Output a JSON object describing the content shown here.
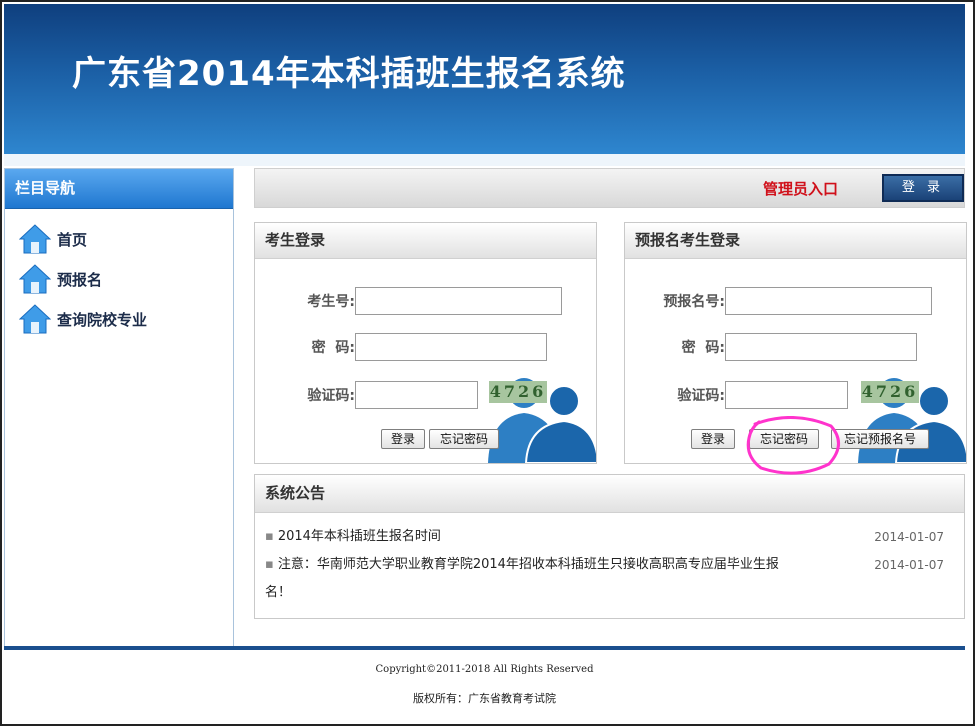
{
  "header": {
    "title": "广东省2014年本科插班生报名系统"
  },
  "sidebar": {
    "title": "栏目导航",
    "items": [
      {
        "label": "首页"
      },
      {
        "label": "预报名"
      },
      {
        "label": "查询院校专业"
      }
    ]
  },
  "admin": {
    "label": "管理员入口",
    "login_button": "登 录"
  },
  "student_login": {
    "title": "考生登录",
    "fields": {
      "id_label": "考生号:",
      "password_label": "密  码:",
      "captcha_label": "验证码:"
    },
    "captcha_text": "4726",
    "buttons": {
      "login": "登录",
      "forgot_password": "忘记密码"
    }
  },
  "pre_login": {
    "title": "预报名考生登录",
    "fields": {
      "id_label": "预报名号:",
      "password_label": "密  码:",
      "captcha_label": "验证码:"
    },
    "captcha_text": "4726",
    "buttons": {
      "login": "登录",
      "forgot_password": "忘记密码",
      "forgot_number": "忘记预报名号"
    }
  },
  "notices": {
    "title": "系统公告",
    "items": [
      {
        "text": "2014年本科插班生报名时间",
        "date": "2014-01-07"
      },
      {
        "text": "注意：华南师范大学职业教育学院2014年招收本科插班生只接收高职高专应届毕业生报",
        "text_cont": "名！",
        "date": "2014-01-07"
      }
    ]
  },
  "footer": {
    "copyright": "Copyright©2011-2018 All Rights Reserved",
    "owner": "版权所有：广东省教育考试院"
  },
  "colors": {
    "header": "#1b5fa5",
    "accent_red": "#d0101a",
    "annotation": "#ff33cc"
  }
}
